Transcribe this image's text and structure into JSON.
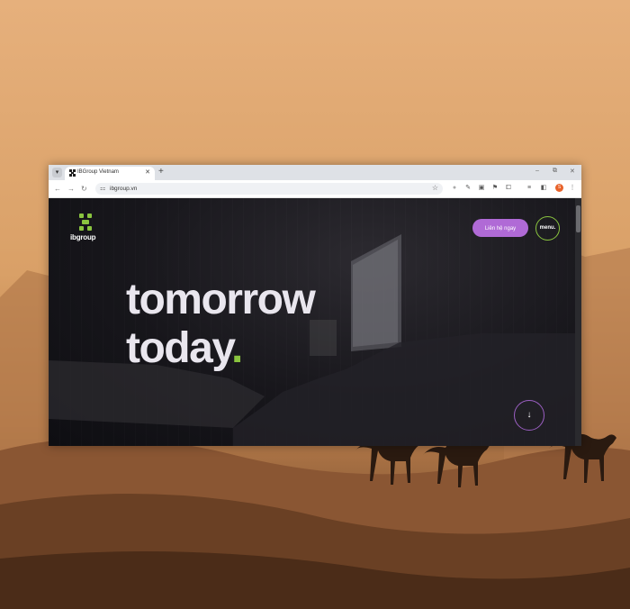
{
  "browser": {
    "tab_title": "IBGroup Vietnam",
    "tab_close": "✕",
    "new_tab": "+",
    "url": "ibgroup.vn",
    "profile_initial": "S",
    "window_controls": [
      "–",
      "⧉",
      "✕"
    ]
  },
  "site": {
    "logo_text": "ibgroup",
    "contact_button": "Liên hệ ngay",
    "menu_button": "menu.",
    "headline_line1": "tomorrow",
    "headline_line2": "today",
    "headline_dot": ".",
    "scroll_down": "↓",
    "accent_green": "#8ac43f",
    "accent_purple": "#b06ad6"
  },
  "icons": {
    "back": "back-arrow-icon",
    "forward": "forward-arrow-icon",
    "reload": "reload-icon",
    "bookmark": "star-icon"
  }
}
